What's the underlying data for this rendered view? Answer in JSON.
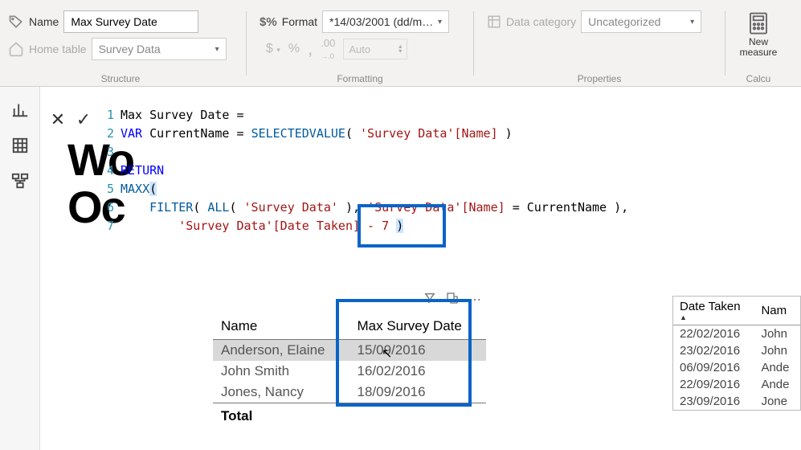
{
  "ribbon": {
    "name_label": "Name",
    "name_value": "Max Survey Date",
    "home_table_label": "Home table",
    "home_table_value": "Survey Data",
    "format_label": "Format",
    "format_value": "*14/03/2001 (dd/m…",
    "data_category_label": "Data category",
    "data_category_value": "Uncategorized",
    "new_measure_label": "New measure",
    "auto_label": "Auto",
    "group_structure": "Structure",
    "group_formatting": "Formatting",
    "group_properties": "Properties",
    "group_calc": "Calcu"
  },
  "formula": {
    "l1": "Max Survey Date =",
    "l2_var": "VAR",
    "l2_name": "CurrentName =",
    "l2_fn": "SELECTEDVALUE",
    "l2_arg": "'Survey Data'[Name]",
    "l4": "RETURN",
    "l5": "MAXX",
    "l6_filter": "FILTER",
    "l6_all": "ALL",
    "l6_table": "'Survey Data'",
    "l6_col": "'Survey Data'[Name]",
    "l6_eq": "= CurrentName",
    "l7": "'Survey Data'[Date Taken] - 7"
  },
  "bg": {
    "t1": "Wo",
    "t2": "Oc"
  },
  "results": {
    "col_name": "Name",
    "col_date": "Max Survey Date",
    "rows": [
      {
        "name": "Anderson, Elaine",
        "date": "15/09/2016"
      },
      {
        "name": "John Smith",
        "date": "16/02/2016"
      },
      {
        "name": "Jones, Nancy",
        "date": "18/09/2016"
      }
    ],
    "total_label": "Total"
  },
  "side_table": {
    "col_date": "Date Taken",
    "col_name": "Nam",
    "rows": [
      {
        "date": "22/02/2016",
        "name": "John"
      },
      {
        "date": "23/02/2016",
        "name": "John"
      },
      {
        "date": "06/09/2016",
        "name": "Ande"
      },
      {
        "date": "22/09/2016",
        "name": "Ande"
      },
      {
        "date": "23/09/2016",
        "name": "Jone"
      }
    ]
  }
}
